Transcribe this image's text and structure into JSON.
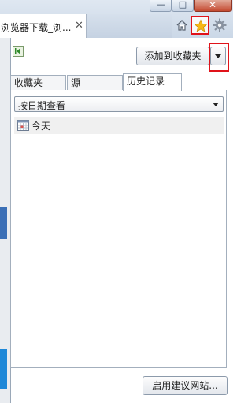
{
  "browser": {
    "tab": {
      "title": "浏览器下载_浏...",
      "close_glyph": "✕"
    },
    "window_controls": {
      "minimize_glyph": "—",
      "maximize_glyph": "□",
      "close_glyph": "✕"
    },
    "icons": {
      "home": "home-icon",
      "favorites": "star-icon",
      "tools": "gear-icon"
    }
  },
  "favorites_pane": {
    "add_button_label": "添加到收藏夹",
    "tabs": [
      {
        "label": "收藏夹",
        "active": false
      },
      {
        "label": "源",
        "active": false
      },
      {
        "label": "历史记录",
        "active": true
      }
    ],
    "view_select": {
      "selected": "按日期查看"
    },
    "history_items": [
      {
        "label": "今天",
        "icon": "calendar-icon"
      }
    ],
    "suggested_sites_button": "启用建议网站...",
    "highlight_color": "#e0131a"
  }
}
